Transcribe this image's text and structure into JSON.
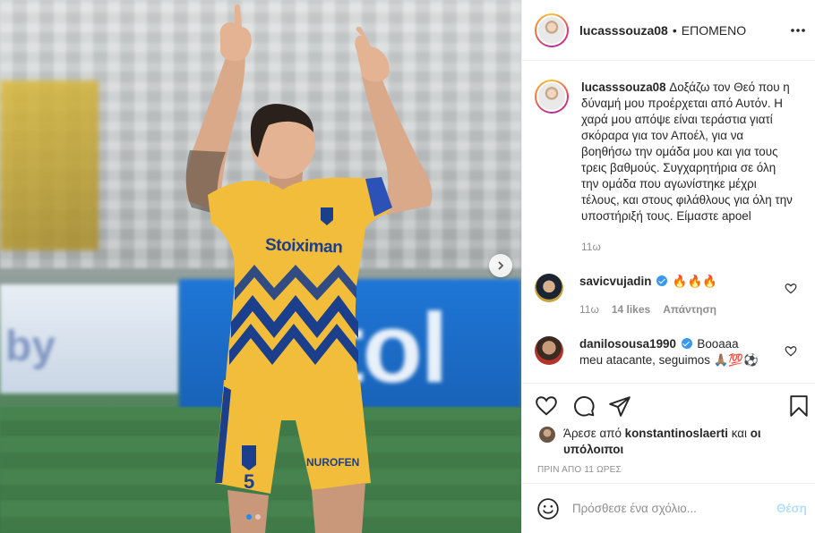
{
  "post": {
    "username": "lucasssouza08",
    "follow_label": "ΕΠΟΜΕΝΟ",
    "separator": "•",
    "caption": "Δοξάζω τον Θεό που η δύναμή μου προέρχεται από Αυτόν. Η χαρά μου απόψε είναι τεράστια γιατί σκόραρα για τον Αποέλ, για να βοηθήσω την ομάδα μου και για τους τρεις βαθμούς. Συγχαρητήρια σε όλη την ομάδα που αγωνίστηκε μέχρι τέλους, και στους φιλάθλους για όλη την υποστήριξή τους. Είμαστε apoel",
    "caption_time": "11ω"
  },
  "photo": {
    "sponsor": "Stoiximan",
    "shorts_sponsor": "NUROFEN",
    "shirt_number": "5",
    "board_left": "by",
    "board_right": "tol",
    "slide_count": 2,
    "active_slide": 1
  },
  "comments": [
    {
      "username": "savicvujadin",
      "verified": true,
      "text": "🔥🔥🔥",
      "time": "11ω",
      "likes": "14 likes",
      "reply_label": "Απάντηση"
    },
    {
      "username": "danilosousa1990",
      "verified": true,
      "text": "Booaaa meu atacante, seguimos 🙏🏽💯⚽"
    }
  ],
  "likes": {
    "prefix": "Άρεσε από",
    "user": "konstantinoslaerti",
    "middle": "και",
    "others": "οι υπόλοιποι"
  },
  "posted_ago": "ΠΡΙΝ ΑΠΟ 11 ΩΡΕΣ",
  "comment_box": {
    "placeholder": "Πρόσθεσε ένα σχόλιο...",
    "post_label": "Θέση"
  },
  "colors": {
    "jersey": "#f2bd3b",
    "jersey_pattern": "#1c3f8c",
    "board": "#1f76d6",
    "pitch": "#3f7a48",
    "verified": "#3897f0",
    "post_button_disabled": "#b2dffc"
  },
  "icons": [
    "more-options-icon",
    "next-arrow-icon",
    "heart-icon",
    "comment-icon",
    "share-icon",
    "bookmark-icon",
    "emoji-icon",
    "verified-badge-icon"
  ]
}
